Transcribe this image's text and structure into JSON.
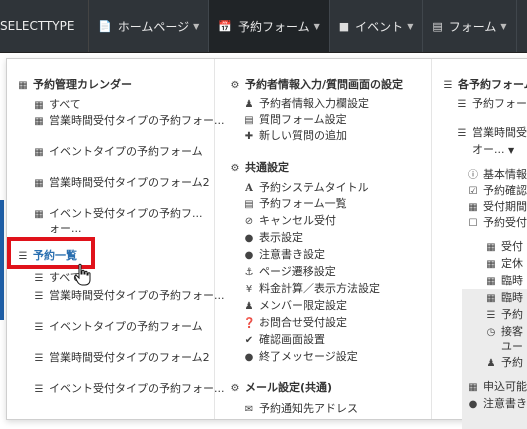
{
  "nav": {
    "brand": "SELECTTYPE",
    "items": [
      {
        "label": "ホームページ",
        "icon": "file-icon"
      },
      {
        "label": "予約フォーム",
        "icon": "calendar-icon",
        "active": true
      },
      {
        "label": "イベント",
        "icon": "comment-icon"
      },
      {
        "label": "フォーム",
        "icon": "list-icon"
      }
    ]
  },
  "col1": {
    "h1": "予約管理カレンダー",
    "cal_items": [
      "すべて",
      "営業時間受付タイプの予約フォー...",
      "イベントタイプの予約フォーム",
      "営業時間受付タイプのフォーム2",
      "イベント受付タイプの予約フ...",
      "ォー..."
    ],
    "h2": "予約一覧",
    "list_items": [
      "すべて",
      "営業時間受付タイプの予約フォー...",
      "イベントタイプの予約フォーム",
      "営業時間受付タイプのフォーム2",
      "イベント受付タイプの予約フォー..."
    ]
  },
  "col2": {
    "h1": "予約者情報入力/質問画面の設定",
    "s1": [
      "予約者情報入力欄設定",
      "質問フォーム設定",
      "新しい質問の追加"
    ],
    "h2": "共通設定",
    "s2": [
      "予約システムタイトル",
      "予約フォーム一覧",
      "キャンセル受付",
      "表示設定",
      "注意書き設定",
      "ページ遷移設定",
      "料金計算／表示方法設定",
      "メンバー限定設定",
      "お問合せ受付設定",
      "確認画面設置",
      "終了メッセージ設定"
    ],
    "h3": "メール設定(共通)",
    "s3": [
      "予約通知先アドレス"
    ]
  },
  "col3": {
    "h1": "各予約フォーム",
    "items": [
      "予約フォー",
      "営業時間受",
      "付タイプの",
      "基本情報",
      "予約確認",
      "受付期間",
      "予約受付",
      "受付",
      "定休",
      "臨時",
      "臨時",
      "予約",
      "接客",
      "ユー",
      "予約",
      "申込可能",
      "注意書き"
    ],
    "sub_label": "オー..."
  }
}
